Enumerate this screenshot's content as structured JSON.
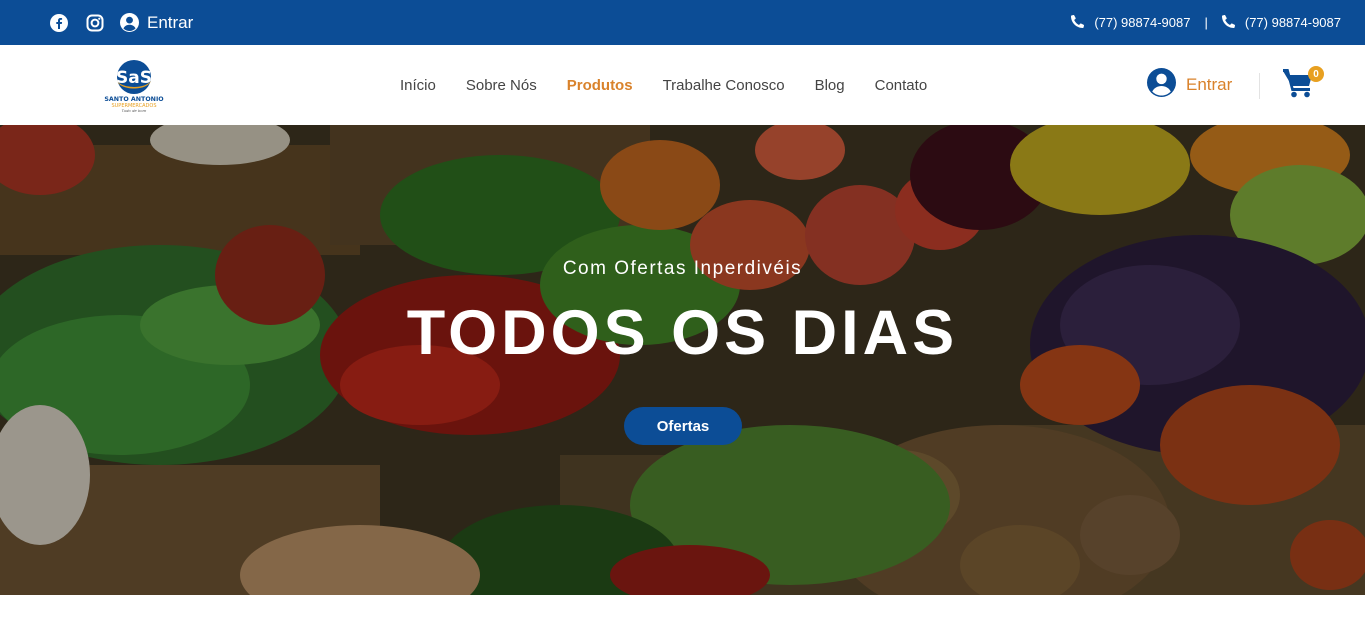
{
  "topbar": {
    "icons": [
      "facebook-icon",
      "instagram-icon",
      "user-circle-icon",
      "phone-icon"
    ],
    "login_label": "Entrar",
    "phone_1": "(77) 98874-9087",
    "separator": "|",
    "phone_2": "(77) 98874-9087"
  },
  "header": {
    "logo_text": "SANTO ANTONIO",
    "logo_subtext": "SUPERMERCADOS",
    "logo_tagline": "Tudo de bom",
    "nav": [
      {
        "label": "Início"
      },
      {
        "label": "Sobre Nós"
      },
      {
        "label": "Produtos"
      },
      {
        "label": "Trabalhe Conosco"
      },
      {
        "label": "Blog"
      },
      {
        "label": "Contato"
      }
    ],
    "active_nav": "Produtos",
    "login_label": "Entrar",
    "cart_count": "0"
  },
  "hero": {
    "subtitle": "Com Ofertas Inperdivéis",
    "title": "TODOS OS DIAS",
    "button_label": "Ofertas"
  },
  "colors": {
    "primary_blue": "#0c4d96",
    "accent_orange": "#d9822b",
    "badge_orange": "#e8a020"
  }
}
